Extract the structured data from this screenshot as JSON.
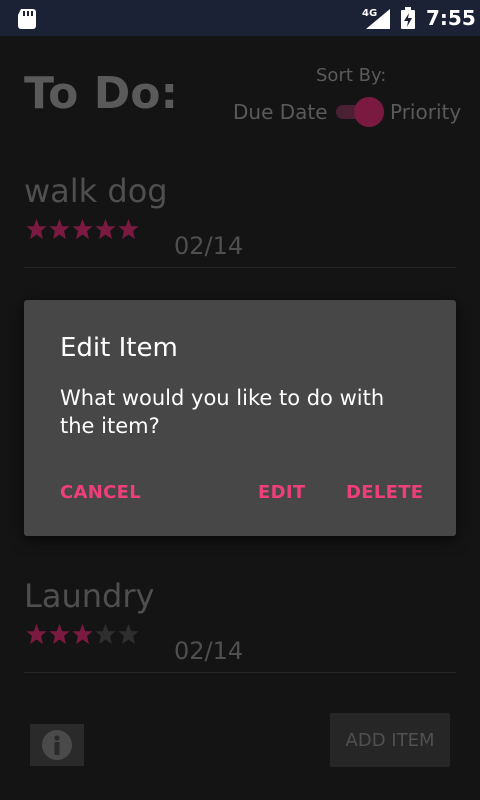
{
  "status_bar": {
    "network": "4G",
    "time": "7:55"
  },
  "app": {
    "title": "To Do:",
    "sort_label": "Sort By:",
    "sort_due_label": "Due Date",
    "sort_priority_label": "Priority",
    "toggle_on": true
  },
  "items": [
    {
      "name": "walk dog",
      "stars": 5,
      "date": "02/14"
    },
    {
      "name": "Laundry",
      "stars": 3,
      "date": "02/14"
    }
  ],
  "footer": {
    "add_label": "ADD ITEM",
    "info_icon": "info-icon"
  },
  "dialog": {
    "title": "Edit Item",
    "message": "What would you like to do with the item?",
    "cancel_label": "CANCEL",
    "edit_label": "EDIT",
    "delete_label": "DELETE"
  },
  "colors": {
    "accent": "#ef3f7a",
    "star_filled": "#7a1a40",
    "star_empty": "#2e2e2e",
    "status_bar": "#1b2236",
    "dialog_bg": "#474747",
    "background": "#141414"
  }
}
